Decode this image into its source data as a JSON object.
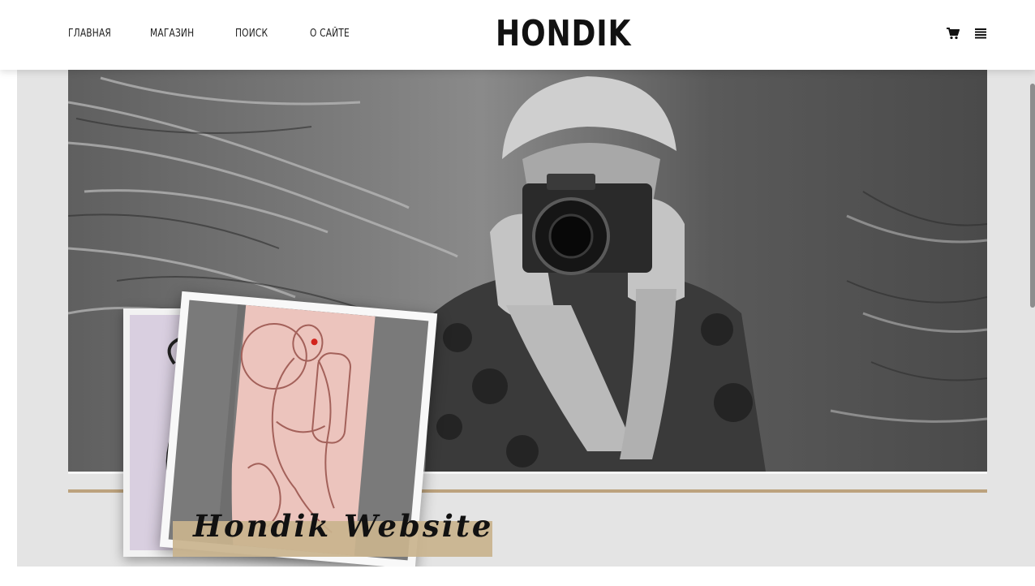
{
  "header": {
    "nav": [
      "ГЛАВНАЯ",
      "МАГАЗИН",
      "ПОИСК",
      "О САЙТЕ"
    ],
    "logo": "HONDIK",
    "icons": [
      "cart-icon",
      "menu-icon"
    ]
  },
  "hero": {
    "caption": "Hondik Website",
    "accent_color": "#bca27d",
    "caption_bg_color": "#c9b38d"
  }
}
